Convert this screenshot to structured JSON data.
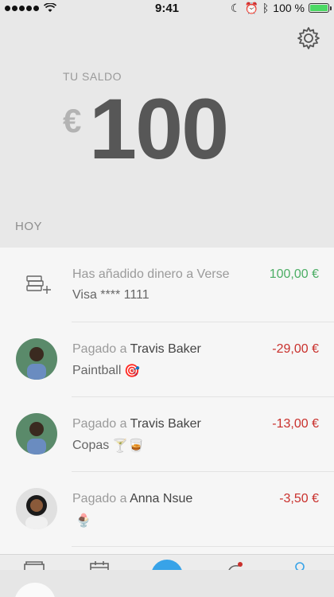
{
  "status_bar": {
    "time": "9:41",
    "battery_text": "100 %",
    "battery_level": 1.0
  },
  "header": {
    "settings_icon": "gear-icon",
    "balance_label": "TU SALDO",
    "currency": "€",
    "balance": "100"
  },
  "section": {
    "title": "HOY"
  },
  "transactions": [
    {
      "icon": "money-add-icon",
      "prefix": "Has añadido dinero a Verse",
      "name": "",
      "detail": "Visa **** 1111",
      "emoji": "",
      "amount": "100,00 €",
      "amount_color": "#4cae65"
    },
    {
      "icon": "avatar",
      "prefix": "Pagado a ",
      "name": "Travis Baker",
      "detail": "Paintball",
      "emoji": "🎯",
      "amount": "-29,00 €",
      "amount_color": "#c9302c"
    },
    {
      "icon": "avatar",
      "prefix": "Pagado a ",
      "name": "Travis Baker",
      "detail": "Copas",
      "emoji": "🍸🥃",
      "amount": "-13,00 €",
      "amount_color": "#c9302c"
    },
    {
      "icon": "avatar",
      "prefix": "Pagado a ",
      "name": "Anna Nsue",
      "detail": "",
      "emoji": "🍨",
      "amount": "-3,50 €",
      "amount_color": "#c9302c"
    }
  ],
  "tabbar": {
    "items": [
      "wallet-icon",
      "calendar-icon",
      "pay-button",
      "activity-icon",
      "profile-icon"
    ],
    "accent": "#38a3e8"
  }
}
